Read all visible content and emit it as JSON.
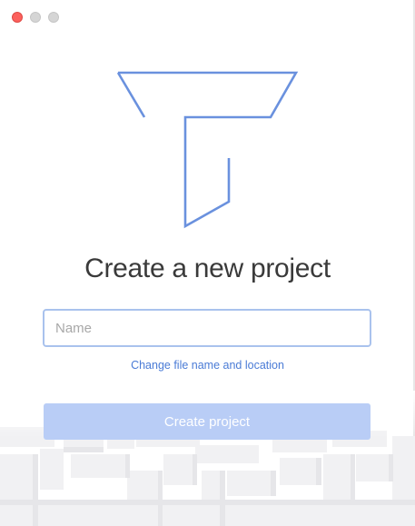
{
  "window": {
    "controls": [
      "close",
      "minimize",
      "maximize"
    ]
  },
  "logo": {
    "name": "t-logo",
    "color": "#6a91de"
  },
  "heading": "Create a new project",
  "name_field": {
    "value": "",
    "placeholder": "Name"
  },
  "change_link": "Change file name and location",
  "create_button": {
    "label": "Create project",
    "color": "#b9cdf6",
    "state": "disabled"
  },
  "colors": {
    "accent": "#4a7bd6",
    "input_border": "#a9c2ed",
    "close": "#fc605c"
  }
}
